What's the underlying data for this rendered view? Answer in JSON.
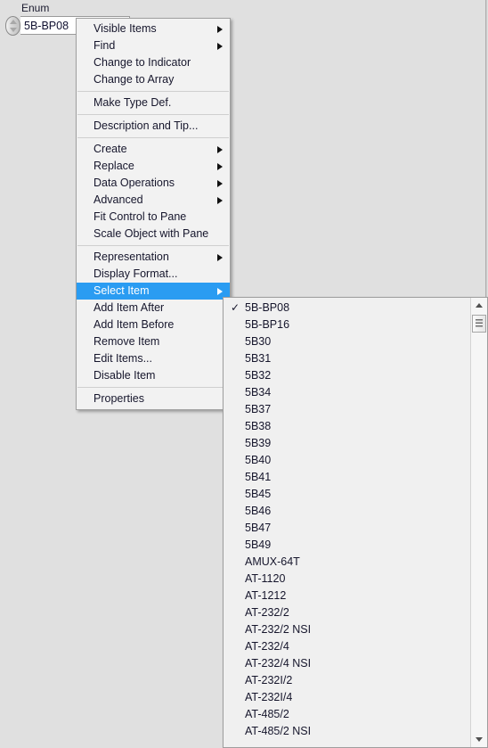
{
  "window": {
    "background_color": "#e0e0e0"
  },
  "enum_control": {
    "label": "Enum",
    "value": "5B-BP08",
    "increment_icon": "triangle-up-icon",
    "decrement_icon": "triangle-down-icon"
  },
  "context_menu": {
    "highlight_color": "#2a9cf2",
    "groups": [
      {
        "items": [
          {
            "label": "Visible Items",
            "submenu": true
          },
          {
            "label": "Find",
            "submenu": true
          },
          {
            "label": "Change to Indicator",
            "submenu": false
          },
          {
            "label": "Change to Array",
            "submenu": false
          }
        ]
      },
      {
        "items": [
          {
            "label": "Make Type Def.",
            "submenu": false
          }
        ]
      },
      {
        "items": [
          {
            "label": "Description and Tip...",
            "submenu": false
          }
        ]
      },
      {
        "items": [
          {
            "label": "Create",
            "submenu": true
          },
          {
            "label": "Replace",
            "submenu": true
          },
          {
            "label": "Data Operations",
            "submenu": true
          },
          {
            "label": "Advanced",
            "submenu": true
          },
          {
            "label": "Fit Control to Pane",
            "submenu": false
          },
          {
            "label": "Scale Object with Pane",
            "submenu": false
          }
        ]
      },
      {
        "items": [
          {
            "label": "Representation",
            "submenu": true
          },
          {
            "label": "Display Format...",
            "submenu": false
          },
          {
            "label": "Select Item",
            "submenu": true,
            "selected": true
          },
          {
            "label": "Add Item After",
            "submenu": false
          },
          {
            "label": "Add Item Before",
            "submenu": false
          },
          {
            "label": "Remove Item",
            "submenu": false
          },
          {
            "label": "Edit Items...",
            "submenu": false
          },
          {
            "label": "Disable Item",
            "submenu": false
          }
        ]
      },
      {
        "items": [
          {
            "label": "Properties",
            "submenu": false
          }
        ]
      }
    ]
  },
  "select_item_submenu": {
    "checked_value": "5B-BP08",
    "check_glyph": "✓",
    "scroll_up_icon": "triangle-up-icon",
    "scroll_down_icon": "triangle-down-icon",
    "items": [
      {
        "label": "5B-BP08",
        "checked": true
      },
      {
        "label": "5B-BP16",
        "checked": false
      },
      {
        "label": "5B30",
        "checked": false
      },
      {
        "label": "5B31",
        "checked": false
      },
      {
        "label": "5B32",
        "checked": false
      },
      {
        "label": "5B34",
        "checked": false
      },
      {
        "label": "5B37",
        "checked": false
      },
      {
        "label": "5B38",
        "checked": false
      },
      {
        "label": "5B39",
        "checked": false
      },
      {
        "label": "5B40",
        "checked": false
      },
      {
        "label": "5B41",
        "checked": false
      },
      {
        "label": "5B45",
        "checked": false
      },
      {
        "label": "5B46",
        "checked": false
      },
      {
        "label": "5B47",
        "checked": false
      },
      {
        "label": "5B49",
        "checked": false
      },
      {
        "label": "AMUX-64T",
        "checked": false
      },
      {
        "label": "AT-1120",
        "checked": false
      },
      {
        "label": "AT-1212",
        "checked": false
      },
      {
        "label": "AT-232/2",
        "checked": false
      },
      {
        "label": "AT-232/2 NSI",
        "checked": false
      },
      {
        "label": "AT-232/4",
        "checked": false
      },
      {
        "label": "AT-232/4 NSI",
        "checked": false
      },
      {
        "label": "AT-232I/2",
        "checked": false
      },
      {
        "label": "AT-232I/4",
        "checked": false
      },
      {
        "label": "AT-485/2",
        "checked": false
      },
      {
        "label": "AT-485/2 NSI",
        "checked": false
      }
    ]
  }
}
